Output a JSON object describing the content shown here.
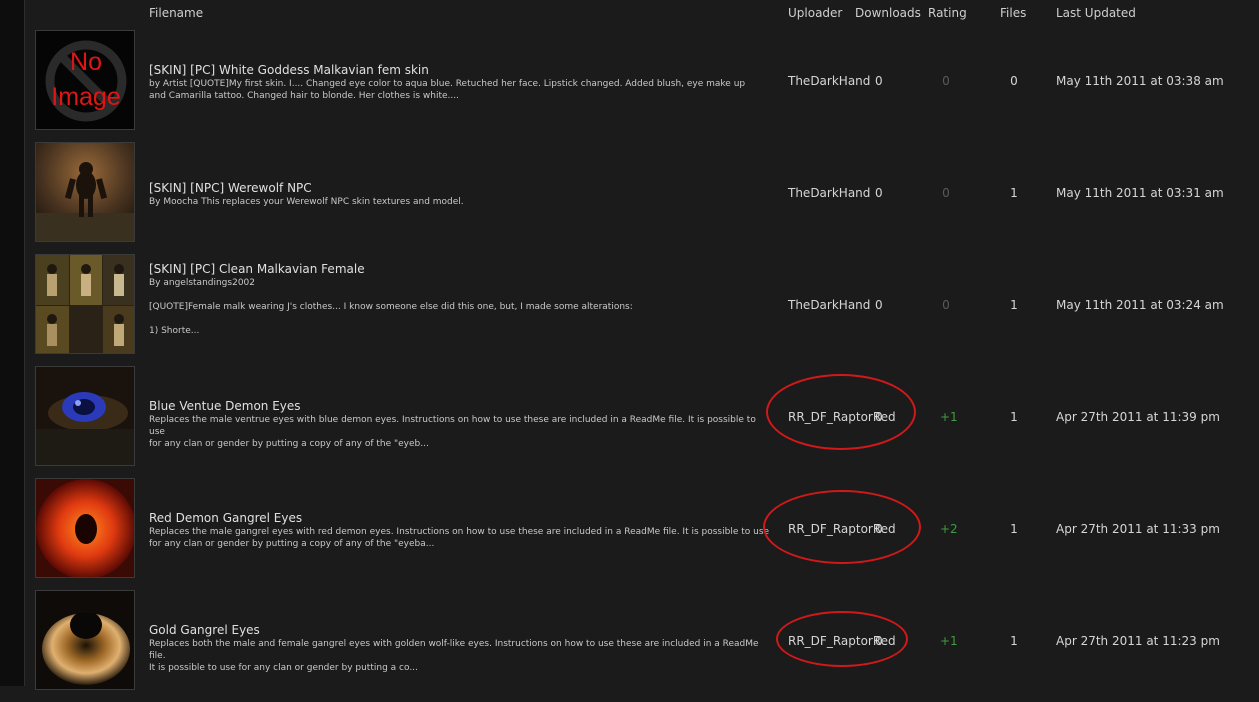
{
  "columns": {
    "filename": "Filename",
    "uploader": "Uploader",
    "downloads": "Downloads",
    "rating": "Rating",
    "files": "Files",
    "last_updated": "Last Updated"
  },
  "rows": [
    {
      "thumb_text_1": "No",
      "thumb_text_2": "Image",
      "title": "[SKIN] [PC] White Goddess Malkavian fem skin",
      "description": "by Artist [QUOTE]My first skin. I.... Changed eye color to aqua blue. Retuched her face. Lipstick changed. Added blush, eye make up\nand Camarilla tattoo. Changed hair to blonde. Her clothes is white....",
      "uploader": "TheDarkHand",
      "downloads": "0",
      "rating": "0",
      "files": "0",
      "updated": "May 11th 2011 at 03:38 am"
    },
    {
      "title": "[SKIN] [NPC] Werewolf NPC",
      "description": "By Moocha This replaces your Werewolf NPC skin textures and model.",
      "uploader": "TheDarkHand",
      "downloads": "0",
      "rating": "0",
      "files": "1",
      "updated": "May 11th 2011 at 03:31 am"
    },
    {
      "title": "[SKIN] [PC] Clean Malkavian Female",
      "description": "By angelstandings2002\n\n[QUOTE]Female malk wearing J's clothes... I know someone else did this one, but, I made some alterations:\n\n1) Shorte...",
      "uploader": "TheDarkHand",
      "downloads": "0",
      "rating": "0",
      "files": "1",
      "updated": "May 11th 2011 at 03:24 am"
    },
    {
      "title": "Blue Ventue Demon Eyes",
      "description": "Replaces the male ventrue eyes with blue demon eyes. Instructions on how to use these are included in a ReadMe file. It is possible to use\nfor any clan or gender by putting a copy of any of the \"eyeb...",
      "uploader": "RR_DF_RaptorRed",
      "downloads": "0",
      "rating": "+1",
      "files": "1",
      "updated": "Apr 27th 2011 at 11:39 pm"
    },
    {
      "title": "Red Demon Gangrel Eyes",
      "description": "Replaces the male gangrel eyes with red demon eyes. Instructions on how to use these are included in a ReadMe file. It is possible to use\nfor any clan or gender by putting a copy of any of the \"eyeba...",
      "uploader": "RR_DF_RaptorRed",
      "downloads": "0",
      "rating": "+2",
      "files": "1",
      "updated": "Apr 27th 2011 at 11:33 pm"
    },
    {
      "title": "Gold Gangrel Eyes",
      "description": "Replaces both the male and female gangrel eyes with golden wolf-like eyes. Instructions on how to use these are included in a ReadMe file.\nIt is possible to use for any clan or gender by putting a co...",
      "uploader": "RR_DF_RaptorRed",
      "downloads": "0",
      "rating": "+1",
      "files": "1",
      "updated": "Apr 27th 2011 at 11:23 pm"
    }
  ],
  "colors": {
    "background": "#1b1b1b",
    "annotation_circle": "#d11919",
    "rating_positive": "#3f9b3f",
    "rating_zero": "#5a5a5a"
  }
}
